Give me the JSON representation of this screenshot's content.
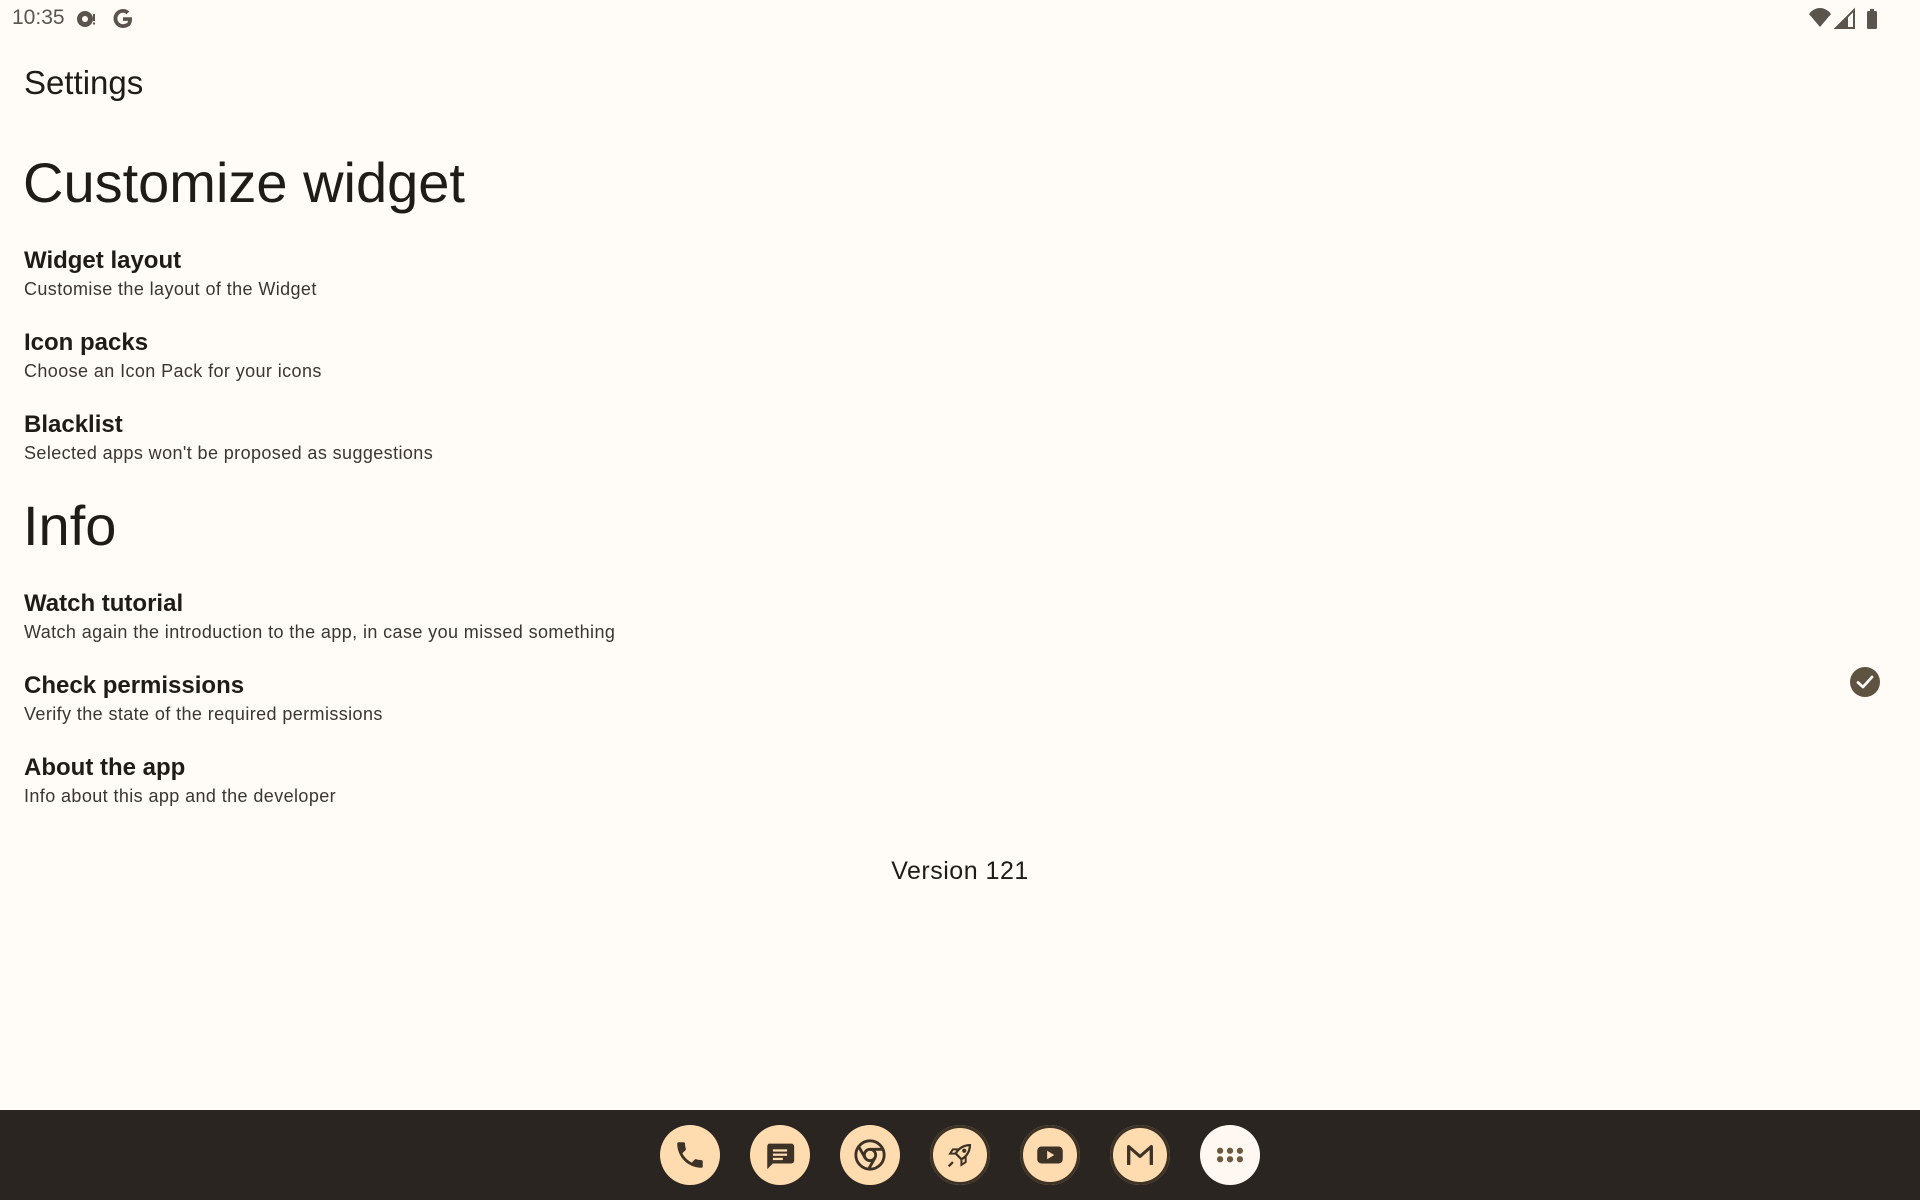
{
  "status_bar": {
    "time": "10:35",
    "left_icons": [
      "sync-notification-icon",
      "google-icon"
    ],
    "right_icons": [
      "wifi-icon",
      "signal-icon",
      "battery-icon"
    ]
  },
  "app_title": "Settings",
  "sections": [
    {
      "header": "Customize widget",
      "items": [
        {
          "title": "Widget layout",
          "summary": "Customise the layout of the Widget"
        },
        {
          "title": "Icon packs",
          "summary": "Choose an Icon Pack for your icons"
        },
        {
          "title": "Blacklist",
          "summary": "Selected apps won't be proposed as suggestions"
        }
      ]
    },
    {
      "header": "Info",
      "items": [
        {
          "title": "Watch tutorial",
          "summary": "Watch again the introduction to the app, in case you missed something"
        },
        {
          "title": "Check permissions",
          "summary": "Verify the state of the required permissions",
          "status_icon": "check-circle-icon"
        },
        {
          "title": "About the app",
          "summary": "Info about this app and the developer"
        }
      ]
    }
  ],
  "version": "Version 121",
  "dock": {
    "apps": [
      "phone-icon",
      "messages-icon",
      "chrome-icon",
      "launcher-rocket-icon",
      "youtube-icon",
      "gmail-icon",
      "app-drawer-icon"
    ]
  },
  "colors": {
    "background": "#fffbf7",
    "text": "#1f1b16",
    "dock_background": "#2a2520",
    "dock_icon": "#ffdcb0",
    "accent": "#5e5240"
  }
}
